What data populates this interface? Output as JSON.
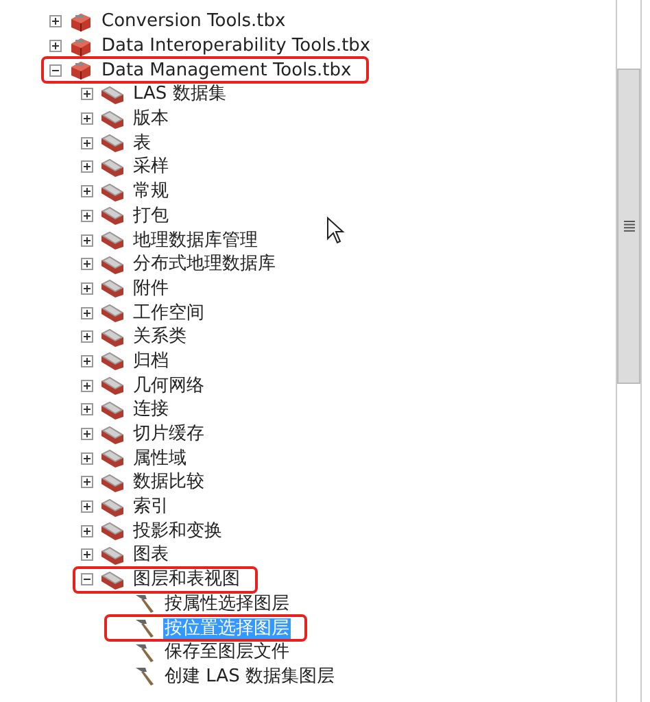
{
  "tree": [
    {
      "kind": "toolbox",
      "label": "Conversion Tools.tbx",
      "expanded": false,
      "highlighted": false,
      "selected": false
    },
    {
      "kind": "toolbox",
      "label": "Data Interoperability Tools.tbx",
      "expanded": false,
      "highlighted": false,
      "selected": false
    },
    {
      "kind": "toolbox",
      "label": "Data Management Tools.tbx",
      "expanded": true,
      "highlighted": true,
      "selected": false,
      "children": [
        {
          "kind": "toolset",
          "label": "LAS 数据集",
          "expanded": false,
          "highlighted": false,
          "selected": false
        },
        {
          "kind": "toolset",
          "label": "版本",
          "expanded": false,
          "highlighted": false,
          "selected": false
        },
        {
          "kind": "toolset",
          "label": "表",
          "expanded": false,
          "highlighted": false,
          "selected": false
        },
        {
          "kind": "toolset",
          "label": "采样",
          "expanded": false,
          "highlighted": false,
          "selected": false
        },
        {
          "kind": "toolset",
          "label": "常规",
          "expanded": false,
          "highlighted": false,
          "selected": false
        },
        {
          "kind": "toolset",
          "label": "打包",
          "expanded": false,
          "highlighted": false,
          "selected": false
        },
        {
          "kind": "toolset",
          "label": "地理数据库管理",
          "expanded": false,
          "highlighted": false,
          "selected": false
        },
        {
          "kind": "toolset",
          "label": "分布式地理数据库",
          "expanded": false,
          "highlighted": false,
          "selected": false
        },
        {
          "kind": "toolset",
          "label": "附件",
          "expanded": false,
          "highlighted": false,
          "selected": false
        },
        {
          "kind": "toolset",
          "label": "工作空间",
          "expanded": false,
          "highlighted": false,
          "selected": false
        },
        {
          "kind": "toolset",
          "label": "关系类",
          "expanded": false,
          "highlighted": false,
          "selected": false
        },
        {
          "kind": "toolset",
          "label": "归档",
          "expanded": false,
          "highlighted": false,
          "selected": false
        },
        {
          "kind": "toolset",
          "label": "几何网络",
          "expanded": false,
          "highlighted": false,
          "selected": false
        },
        {
          "kind": "toolset",
          "label": "连接",
          "expanded": false,
          "highlighted": false,
          "selected": false
        },
        {
          "kind": "toolset",
          "label": "切片缓存",
          "expanded": false,
          "highlighted": false,
          "selected": false
        },
        {
          "kind": "toolset",
          "label": "属性域",
          "expanded": false,
          "highlighted": false,
          "selected": false
        },
        {
          "kind": "toolset",
          "label": "数据比较",
          "expanded": false,
          "highlighted": false,
          "selected": false
        },
        {
          "kind": "toolset",
          "label": "索引",
          "expanded": false,
          "highlighted": false,
          "selected": false
        },
        {
          "kind": "toolset",
          "label": "投影和变换",
          "expanded": false,
          "highlighted": false,
          "selected": false
        },
        {
          "kind": "toolset",
          "label": "图表",
          "expanded": false,
          "highlighted": false,
          "selected": false
        },
        {
          "kind": "toolset",
          "label": "图层和表视图",
          "expanded": true,
          "highlighted": true,
          "selected": false,
          "children": [
            {
              "kind": "tool",
              "label": "按属性选择图层",
              "highlighted": false,
              "selected": false
            },
            {
              "kind": "tool",
              "label": "按位置选择图层",
              "highlighted": true,
              "selected": true
            },
            {
              "kind": "tool",
              "label": "保存至图层文件",
              "highlighted": false,
              "selected": false
            },
            {
              "kind": "tool",
              "label": "创建 LAS 数据集图层",
              "highlighted": false,
              "selected": false
            }
          ]
        }
      ]
    }
  ]
}
